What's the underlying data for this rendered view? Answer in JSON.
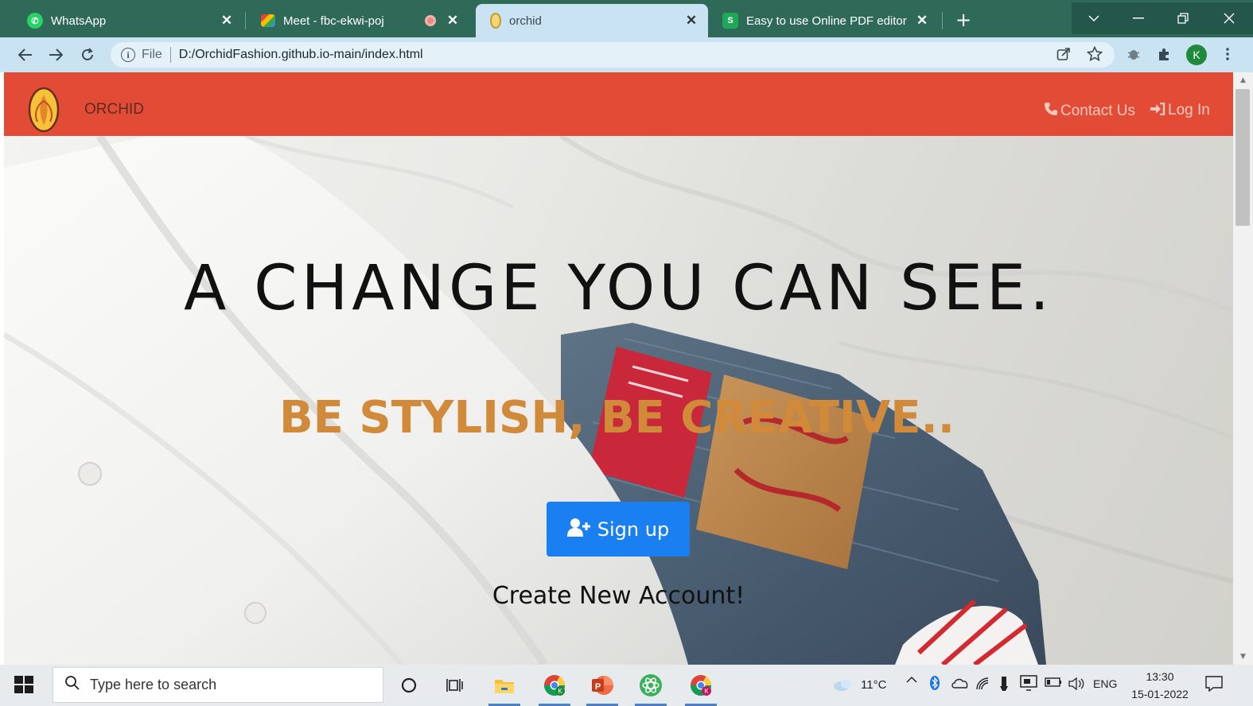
{
  "browser": {
    "tabs": [
      {
        "title": "WhatsApp",
        "favicon": "whatsapp-icon",
        "favicon_color": "#25d366"
      },
      {
        "title": "Meet - fbc-ekwi-poj",
        "favicon": "google-meet-icon",
        "favicon_color": "#00897b"
      },
      {
        "title": "orchid",
        "favicon": "orchid-logo-icon",
        "favicon_color": "#e8c74a",
        "active": true
      },
      {
        "title": "Easy to use Online PDF editor",
        "favicon": "sejda-icon",
        "favicon_color": "#1fa85a",
        "favicon_letter": "S"
      }
    ],
    "address": {
      "scheme": "File",
      "url": "D:/OrchidFashion.github.io-main/index.html"
    },
    "profile_initial": "K",
    "colors": {
      "tabstrip": "#2f6a59",
      "toolbar": "#c9e3f2"
    }
  },
  "site": {
    "brand": "ORCHID",
    "nav": {
      "contact": "Contact Us",
      "login": "Log In"
    },
    "colors": {
      "navbar": "#e24c37",
      "tagline": "#d08a3a",
      "button": "#1a7ff0"
    }
  },
  "hero": {
    "headline": "A CHANGE YOU CAN SEE.",
    "tagline": "BE STYLISH, BE CREATIVE..",
    "signup_label": "Sign up",
    "create_account": "Create New Account!"
  },
  "taskbar": {
    "search_placeholder": "Type here to search",
    "weather": "11°C",
    "language": "ENG",
    "time": "13:30",
    "date": "15-01-2022"
  }
}
